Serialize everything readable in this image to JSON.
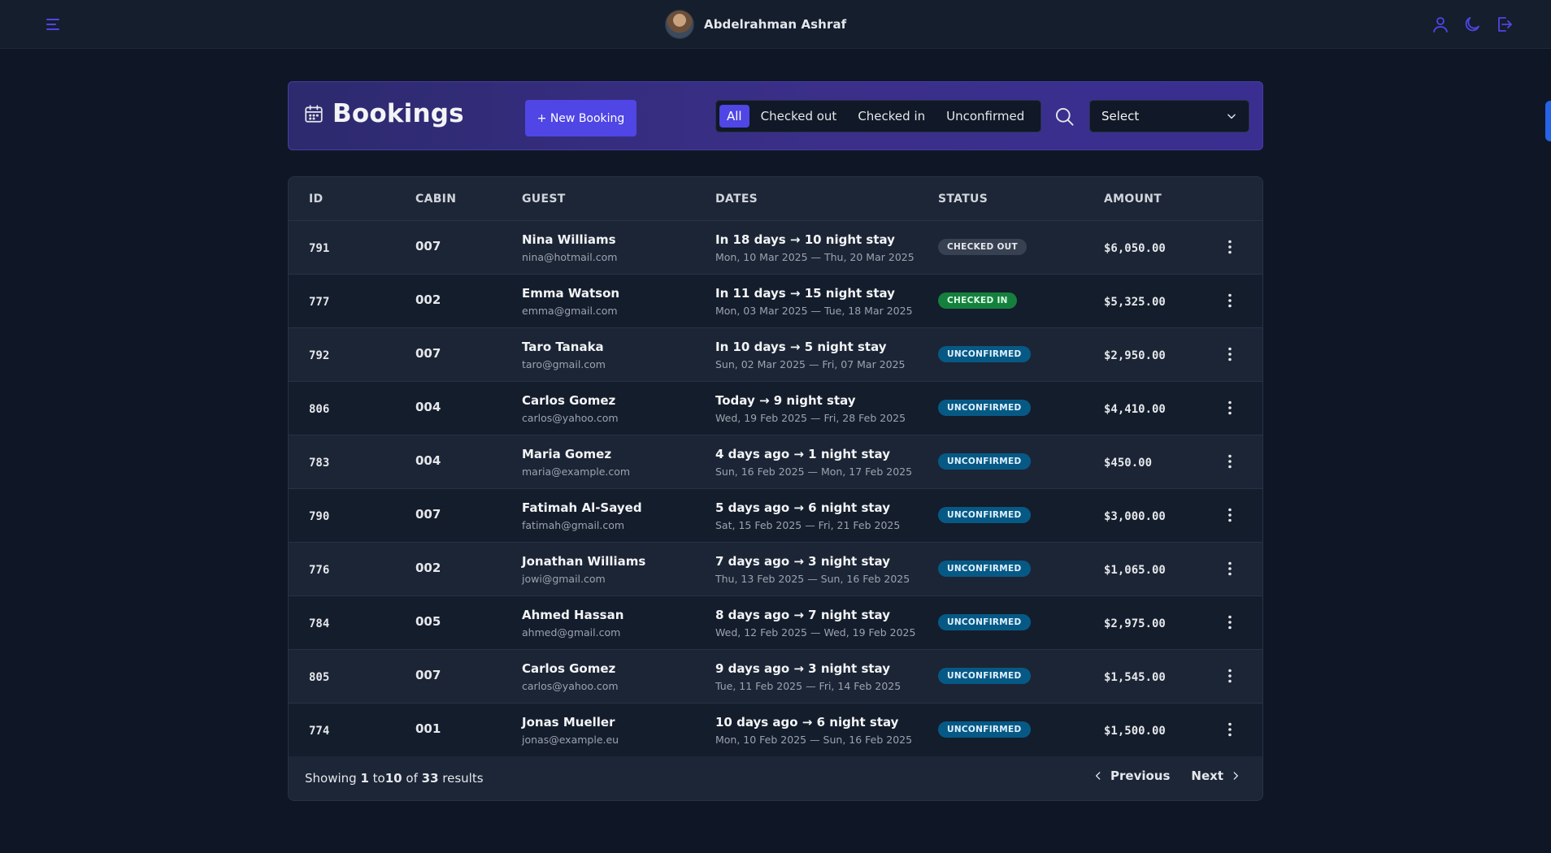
{
  "topbar": {
    "user_name": "Abdelrahman Ashraf",
    "icons": [
      "menu-icon",
      "user-icon",
      "moon-icon",
      "logout-icon"
    ],
    "accent": "#4f46e5"
  },
  "header": {
    "title": "Bookings",
    "new_button": "+ New Booking",
    "filters": [
      "All",
      "Checked out",
      "Checked in",
      "Unconfirmed"
    ],
    "active_filter": "All",
    "select_label": "Select"
  },
  "table": {
    "columns": [
      "ID",
      "CABIN",
      "GUEST",
      "DATES",
      "STATUS",
      "AMOUNT"
    ],
    "rows": [
      {
        "id": "791",
        "cabin": "007",
        "guest_name": "Nina Williams",
        "guest_email": "nina@hotmail.com",
        "stay": "In 18 days → 10 night stay",
        "range": "Mon, 10 Mar 2025 — Thu, 20 Mar 2025",
        "status": "CHECKED OUT",
        "amount": "$6,050.00"
      },
      {
        "id": "777",
        "cabin": "002",
        "guest_name": "Emma Watson",
        "guest_email": "emma@gmail.com",
        "stay": "In 11 days → 15 night stay",
        "range": "Mon, 03 Mar 2025 — Tue, 18 Mar 2025",
        "status": "CHECKED IN",
        "amount": "$5,325.00"
      },
      {
        "id": "792",
        "cabin": "007",
        "guest_name": "Taro Tanaka",
        "guest_email": "taro@gmail.com",
        "stay": "In 10 days → 5 night stay",
        "range": "Sun, 02 Mar 2025 — Fri, 07 Mar 2025",
        "status": "UNCONFIRMED",
        "amount": "$2,950.00"
      },
      {
        "id": "806",
        "cabin": "004",
        "guest_name": "Carlos Gomez",
        "guest_email": "carlos@yahoo.com",
        "stay": "Today → 9 night stay",
        "range": "Wed, 19 Feb 2025 — Fri, 28 Feb 2025",
        "status": "UNCONFIRMED",
        "amount": "$4,410.00"
      },
      {
        "id": "783",
        "cabin": "004",
        "guest_name": "Maria Gomez",
        "guest_email": "maria@example.com",
        "stay": "4 days ago → 1 night stay",
        "range": "Sun, 16 Feb 2025 — Mon, 17 Feb 2025",
        "status": "UNCONFIRMED",
        "amount": "$450.00"
      },
      {
        "id": "790",
        "cabin": "007",
        "guest_name": "Fatimah Al-Sayed",
        "guest_email": "fatimah@gmail.com",
        "stay": "5 days ago → 6 night stay",
        "range": "Sat, 15 Feb 2025 — Fri, 21 Feb 2025",
        "status": "UNCONFIRMED",
        "amount": "$3,000.00"
      },
      {
        "id": "776",
        "cabin": "002",
        "guest_name": "Jonathan Williams",
        "guest_email": "jowi@gmail.com",
        "stay": "7 days ago → 3 night stay",
        "range": "Thu, 13 Feb 2025 — Sun, 16 Feb 2025",
        "status": "UNCONFIRMED",
        "amount": "$1,065.00"
      },
      {
        "id": "784",
        "cabin": "005",
        "guest_name": "Ahmed Hassan",
        "guest_email": "ahmed@gmail.com",
        "stay": "8 days ago → 7 night stay",
        "range": "Wed, 12 Feb 2025 — Wed, 19 Feb 2025",
        "status": "UNCONFIRMED",
        "amount": "$2,975.00"
      },
      {
        "id": "805",
        "cabin": "007",
        "guest_name": "Carlos Gomez",
        "guest_email": "carlos@yahoo.com",
        "stay": "9 days ago → 3 night stay",
        "range": "Tue, 11 Feb 2025 — Fri, 14 Feb 2025",
        "status": "UNCONFIRMED",
        "amount": "$1,545.00"
      },
      {
        "id": "774",
        "cabin": "001",
        "guest_name": "Jonas Mueller",
        "guest_email": "jonas@example.eu",
        "stay": "10 days ago → 6 night stay",
        "range": "Mon, 10 Feb 2025 — Sun, 16 Feb 2025",
        "status": "UNCONFIRMED",
        "amount": "$1,500.00"
      }
    ]
  },
  "status_colors": {
    "CHECKED OUT": {
      "bg": "#374151",
      "fg": "#e5e7eb"
    },
    "CHECKED IN": {
      "bg": "#15803d",
      "fg": "#dcfce7"
    },
    "UNCONFIRMED": {
      "bg": "#075985",
      "fg": "#e0f2fe"
    }
  },
  "footer": {
    "showing_prefix": "Showing",
    "from": "1",
    "to_word": "to",
    "to": "10",
    "of_word": "of",
    "total": "33",
    "results_word": "results",
    "previous": "Previous",
    "next": "Next"
  }
}
